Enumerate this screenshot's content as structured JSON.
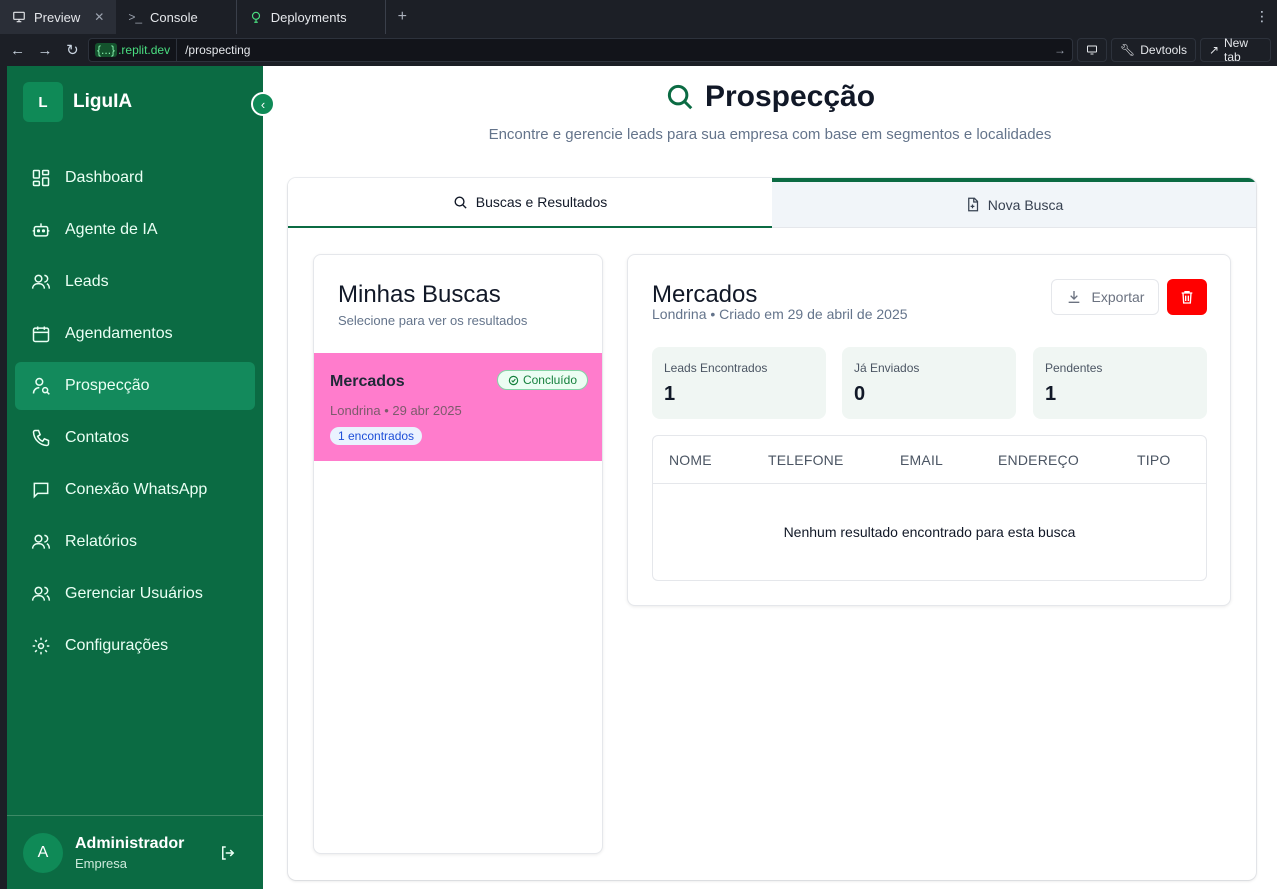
{
  "browser": {
    "tabs": [
      {
        "label": "Preview",
        "icon": "monitor-icon"
      },
      {
        "label": "Console",
        "icon": "terminal-icon"
      },
      {
        "label": "Deployments",
        "icon": "deploy-icon"
      }
    ],
    "url_host_brace": "{...}",
    "url_host": ".replit.dev",
    "url_path": "/prospecting",
    "devtools_label": "Devtools",
    "newtab_label": "New tab"
  },
  "sidebar": {
    "logo_letter": "L",
    "brand": "LiguIA",
    "items": [
      {
        "label": "Dashboard",
        "icon": "dashboard-icon"
      },
      {
        "label": "Agente de IA",
        "icon": "robot-icon"
      },
      {
        "label": "Leads",
        "icon": "users-icon"
      },
      {
        "label": "Agendamentos",
        "icon": "calendar-icon"
      },
      {
        "label": "Prospecção",
        "icon": "user-search-icon",
        "active": true
      },
      {
        "label": "Contatos",
        "icon": "phone-icon"
      },
      {
        "label": "Conexão WhatsApp",
        "icon": "message-icon"
      },
      {
        "label": "Relatórios",
        "icon": "users-icon"
      },
      {
        "label": "Gerenciar Usuários",
        "icon": "users-icon"
      },
      {
        "label": "Configurações",
        "icon": "gear-icon"
      }
    ],
    "user": {
      "initial": "A",
      "name": "Administrador",
      "role": "Empresa"
    }
  },
  "page": {
    "title": "Prospecção",
    "subtitle": "Encontre e gerencie leads para sua empresa com base em segmentos e localidades",
    "tabs": [
      {
        "label": "Buscas e Resultados",
        "icon": "search-icon"
      },
      {
        "label": "Nova Busca",
        "icon": "file-plus-icon"
      }
    ]
  },
  "searches": {
    "title": "Minhas Buscas",
    "subtitle": "Selecione para ver os resultados",
    "items": [
      {
        "name": "Mercados",
        "status": "Concluído",
        "meta": "Londrina • 29 abr 2025",
        "count": "1 encontrados"
      }
    ]
  },
  "detail": {
    "title": "Mercados",
    "meta": "Londrina • Criado em 29 de abril de 2025",
    "export_label": "Exportar",
    "stats": [
      {
        "label": "Leads Encontrados",
        "value": "1"
      },
      {
        "label": "Já Enviados",
        "value": "0"
      },
      {
        "label": "Pendentes",
        "value": "1"
      }
    ],
    "columns": [
      "NOME",
      "TELEFONE",
      "EMAIL",
      "ENDEREÇO",
      "TIPO"
    ],
    "empty_message": "Nenhum resultado encontrado para esta busca"
  },
  "colors": {
    "sidebar": "#0b6b43",
    "sidebar_active": "#138a5c",
    "selected_item": "#ff7ccc",
    "delete": "#ff0000"
  }
}
